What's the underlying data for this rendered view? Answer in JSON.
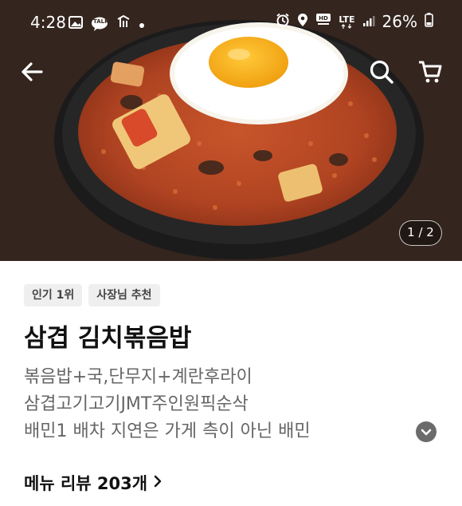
{
  "status_bar": {
    "time": "4:28",
    "talk_label": "TALK",
    "network_label": "LTE",
    "battery": "26%"
  },
  "hero": {
    "pager": "1 / 2"
  },
  "nav": {
    "icons": [
      "back-arrow-icon",
      "share-icon",
      "search-icon",
      "cart-icon"
    ]
  },
  "badges": [
    "인기 1위",
    "사장님 추천"
  ],
  "menu": {
    "title": "삼겹 김치볶음밥",
    "description_lines": [
      "볶음밥+국,단무지+계란후라이",
      "삼겹고기고기JMT주인원픽순삭",
      "배민1 배차 지연은 가게 측이 아닌 배민"
    ]
  },
  "reviews": {
    "label": "메뉴 리뷰 203개"
  }
}
